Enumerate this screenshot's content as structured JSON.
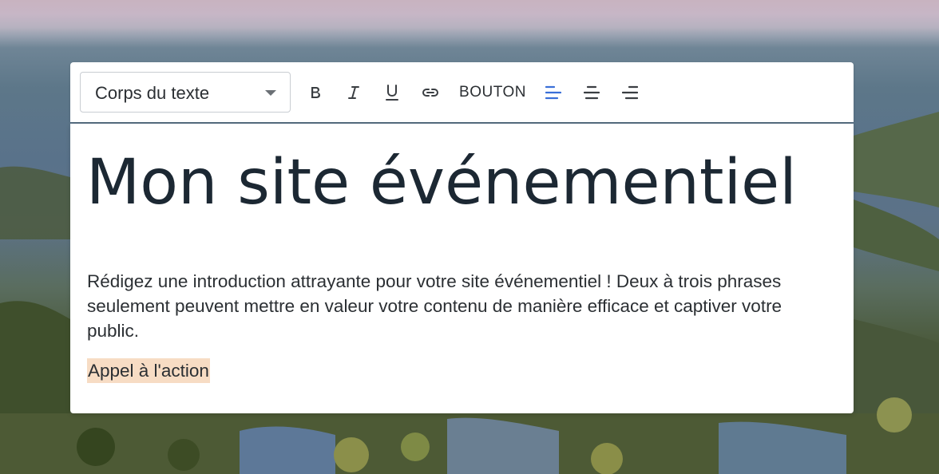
{
  "toolbar": {
    "text_style_select": "Corps du texte",
    "bold_icon": "bold-icon",
    "italic_icon": "italic-icon",
    "underline_icon": "underline-icon",
    "link_icon": "link-icon",
    "button_label": "BOUTON",
    "align_left_icon": "align-left-icon",
    "align_center_icon": "align-center-icon",
    "align_right_icon": "align-right-icon",
    "active_alignment": "left",
    "accent_color": "#3a6fd8"
  },
  "content": {
    "title": "Mon site événementiel",
    "intro": "Rédigez une introduction attrayante pour votre site événementiel ! Deux à trois phrases seulement peuvent mettre en valeur votre contenu de manière efficace et captiver votre public.",
    "cta_label": "Appel à l'action",
    "cta_highlight_color": "#f7dcc4"
  }
}
